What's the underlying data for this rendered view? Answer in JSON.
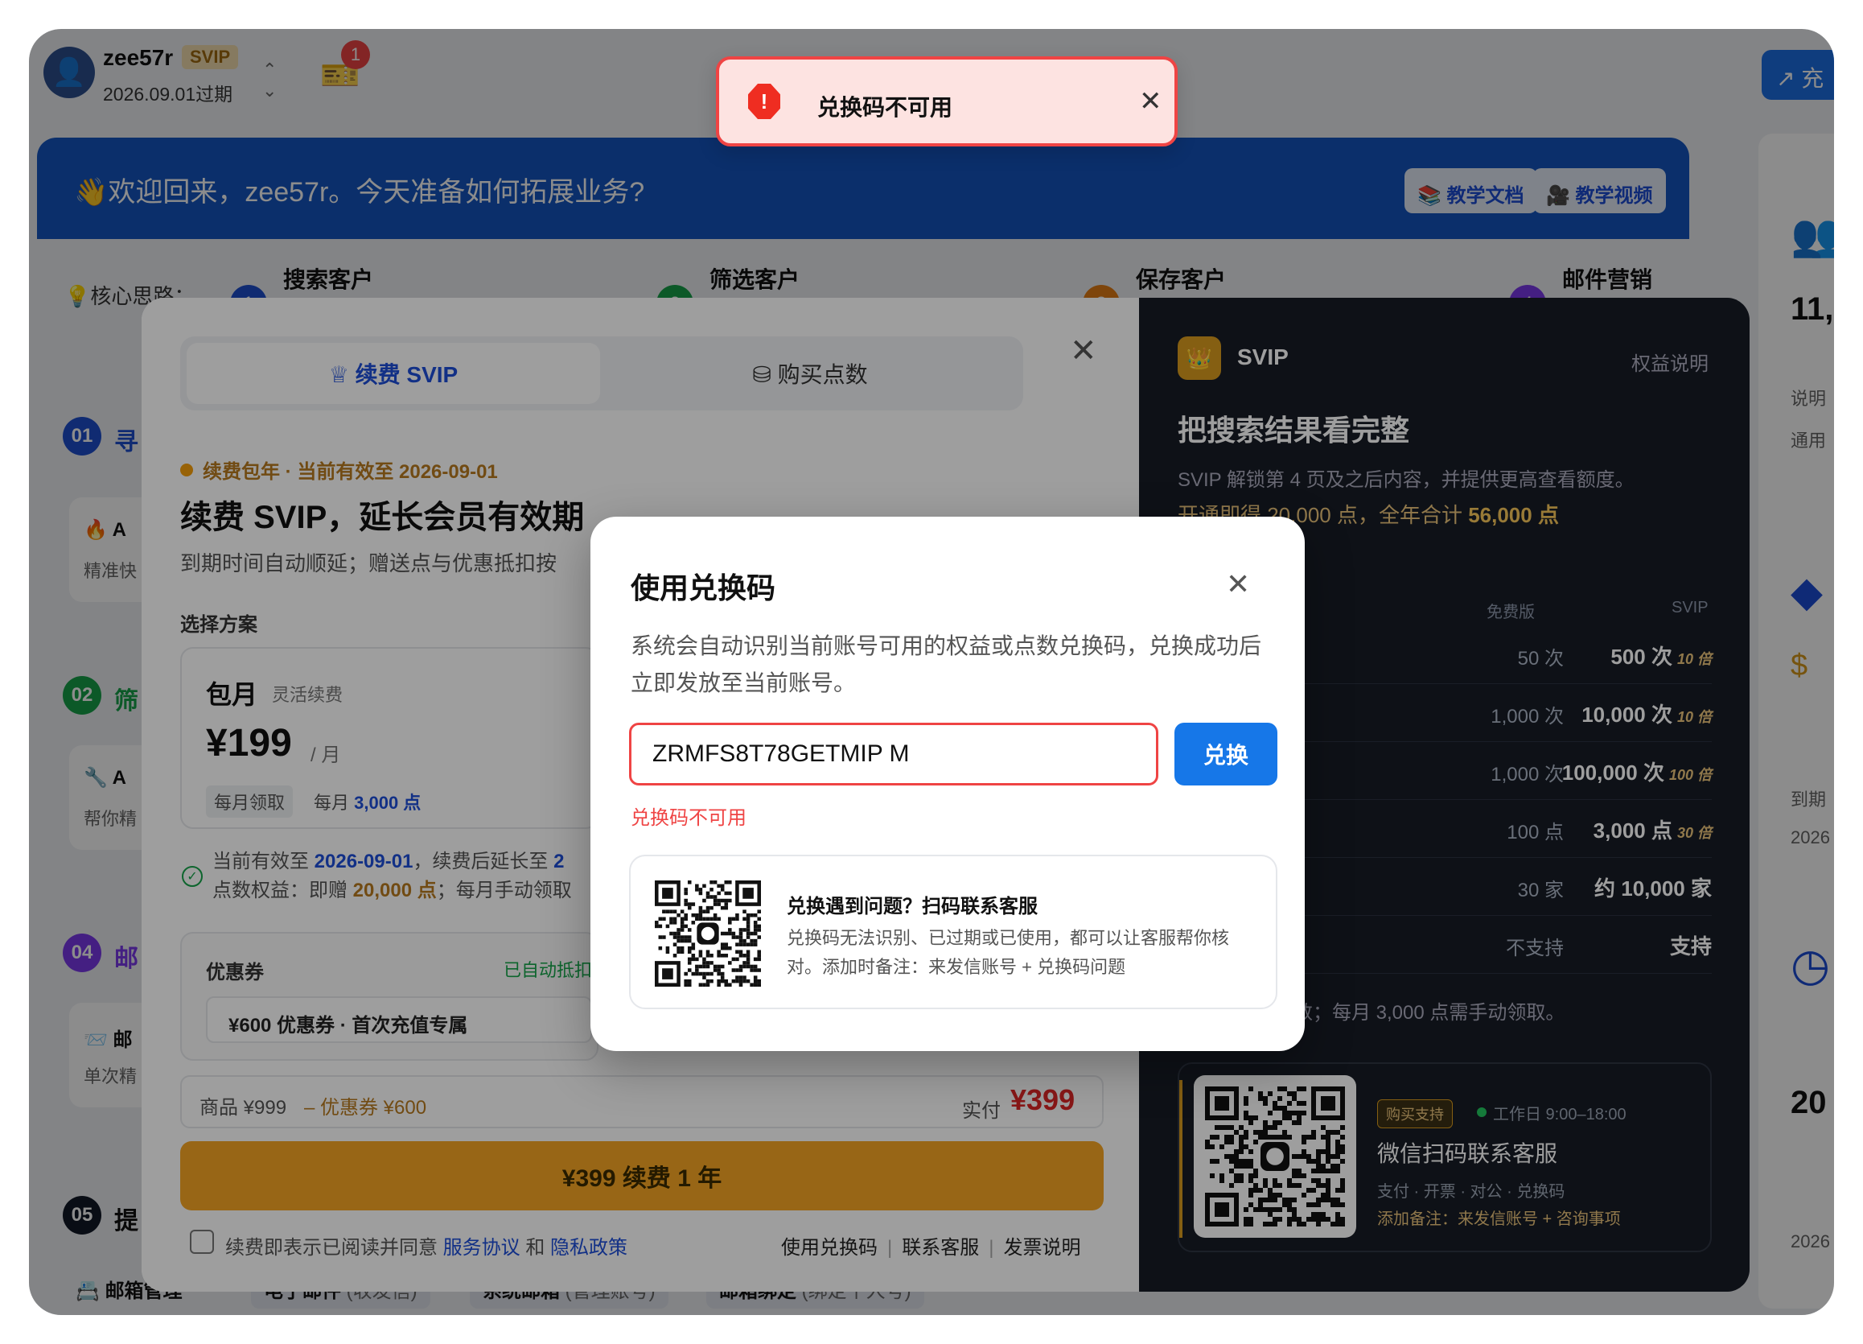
{
  "user": {
    "name": "zee57r",
    "badge": "SVIP",
    "expire": "2026.09.01过期",
    "notif_count": "1"
  },
  "topright": {
    "label": "充"
  },
  "banner": {
    "welcome": "👋欢迎回来，zee57r。今天准备如何拓展业务?",
    "doc_btn": "📚 教学文档",
    "video_btn": "🎥 教学视频"
  },
  "steps": {
    "core_label": "💡核心思路：",
    "items": [
      {
        "num": "1",
        "label": "搜索客户",
        "color": "#1e4fd0"
      },
      {
        "num": "2",
        "label": "筛选客户",
        "color": "#16a34a"
      },
      {
        "num": "3",
        "label": "保存客户",
        "color": "#e67e14"
      },
      {
        "num": "4",
        "label": "邮件营销",
        "color": "#7c3aed"
      }
    ]
  },
  "sections": [
    {
      "num": "01",
      "title": "寻",
      "color": "#1e4fd0",
      "card_title": "🔥 A",
      "card_sub": "精准快"
    },
    {
      "num": "02",
      "title": "筛",
      "color": "#16a34a",
      "card_title": "🔧 A",
      "card_sub": "帮你精"
    },
    {
      "num": "04",
      "title": "邮",
      "color": "#7c3aed",
      "card_title": "📨 邮",
      "card_sub": "单次精"
    },
    {
      "num": "05",
      "title": "提",
      "color": "#111827"
    }
  ],
  "bottom_tabs": [
    {
      "icon": "📇",
      "label": "邮箱管理",
      "sub": ""
    },
    {
      "label": "电子邮件",
      "sub": "(收发信)"
    },
    {
      "label": "系统邮箱",
      "sub": "(管理账号)"
    },
    {
      "label": "邮箱绑定",
      "sub": "(绑定个人号)"
    }
  ],
  "right_col": {
    "stat1": "11,",
    "s1a": "说明",
    "s1b": "通用",
    "stat2": "20",
    "s2a": "到期",
    "s2b": "2026",
    "s2c": "2026"
  },
  "renew": {
    "tab_svip": "♕ 续费 SVIP",
    "tab_points": "⛁ 购买点数",
    "subtitle": "续费包年 · 当前有效至 2026-09-01",
    "title": "续费 SVIP，延长会员有效期",
    "desc": "到期时间自动顺延；赠送点与优惠抵扣按",
    "plan_label": "选择方案",
    "plan": {
      "name": "包月",
      "tag": "灵活续费",
      "price": "¥199",
      "unit": "/ 月",
      "chip": "每月领取",
      "pts_pre": "每月",
      "pts_val": "3,000 点"
    },
    "effect": {
      "a_pre": "当前有效至 ",
      "a_date": "2026-09-01",
      "a_mid": "，续费后延长至 ",
      "a_tail": "2",
      "b_pre": "点数权益：即赠 ",
      "b_val": "20,000 点",
      "b_tail": "；每月手动领取"
    },
    "coupon": {
      "label": "优惠券",
      "auto": "已自动抵扣",
      "value": "¥600 优惠券 · 首次充值专属"
    },
    "summary": {
      "goods": "商品 ¥999",
      "discount": "– 优惠券 ¥600",
      "paid_label": "实付",
      "paid": "¥399"
    },
    "pay_btn": "¥399 续费 1 年",
    "agree_pre": "续费即表示已阅读并同意 ",
    "agree_terms": "服务协议",
    "agree_and": " 和 ",
    "agree_privacy": "隐私政策",
    "links": [
      "使用兑换码",
      "联系客服",
      "发票说明"
    ]
  },
  "svip_panel": {
    "name": "SVIP",
    "benefit_link": "权益说明",
    "title": "把搜索结果看完整",
    "desc": "SVIP 解锁第 4 页及之后内容，并提供更高查看额度。",
    "line_pre": "开通即得 20,000 点，全年合计 ",
    "line_val": "56,000 点",
    "col_free": "免费版",
    "col_svip": "SVIP",
    "rows": [
      {
        "free": "50 次",
        "svip": "500 次",
        "mult": "10 倍"
      },
      {
        "free": "1,000 次",
        "svip": "10,000 次",
        "mult": "10 倍"
      },
      {
        "free": "1,000 次",
        "svip": "100,000 次",
        "mult": "100 倍"
      },
      {
        "free": "100 点",
        "svip": "3,000 点",
        "mult": "30 倍"
      },
      {
        "free": "30 家",
        "svip": "约 10,000 家",
        "mult": ""
      },
      {
        "free": "不支持",
        "svip": "支持",
        "mult": ""
      }
    ],
    "note": "含开通即赠点数；每月 3,000 点需手动领取。",
    "support": {
      "tag": "购买支持",
      "hours": "工作日 9:00–18:00",
      "title": "微信扫码联系客服",
      "sub": "支付 · 开票 · 对公 · 兑换码",
      "note": "添加备注：来发信账号 + 咨询事项"
    }
  },
  "redeem": {
    "title": "使用兑换码",
    "desc": "系统会自动识别当前账号可用的权益或点数兑换码，兑换成功后立即发放至当前账号。",
    "input_value": "ZRMFS8T78GETMIP M",
    "button": "兑换",
    "error": "兑换码不可用",
    "help_title": "兑换遇到问题？扫码联系客服",
    "help_text": "兑换码无法识别、已过期或已使用，都可以让客服帮你核对。添加时备注：来发信账号 + 兑换码问题"
  },
  "toast": {
    "text": "兑换码不可用"
  }
}
